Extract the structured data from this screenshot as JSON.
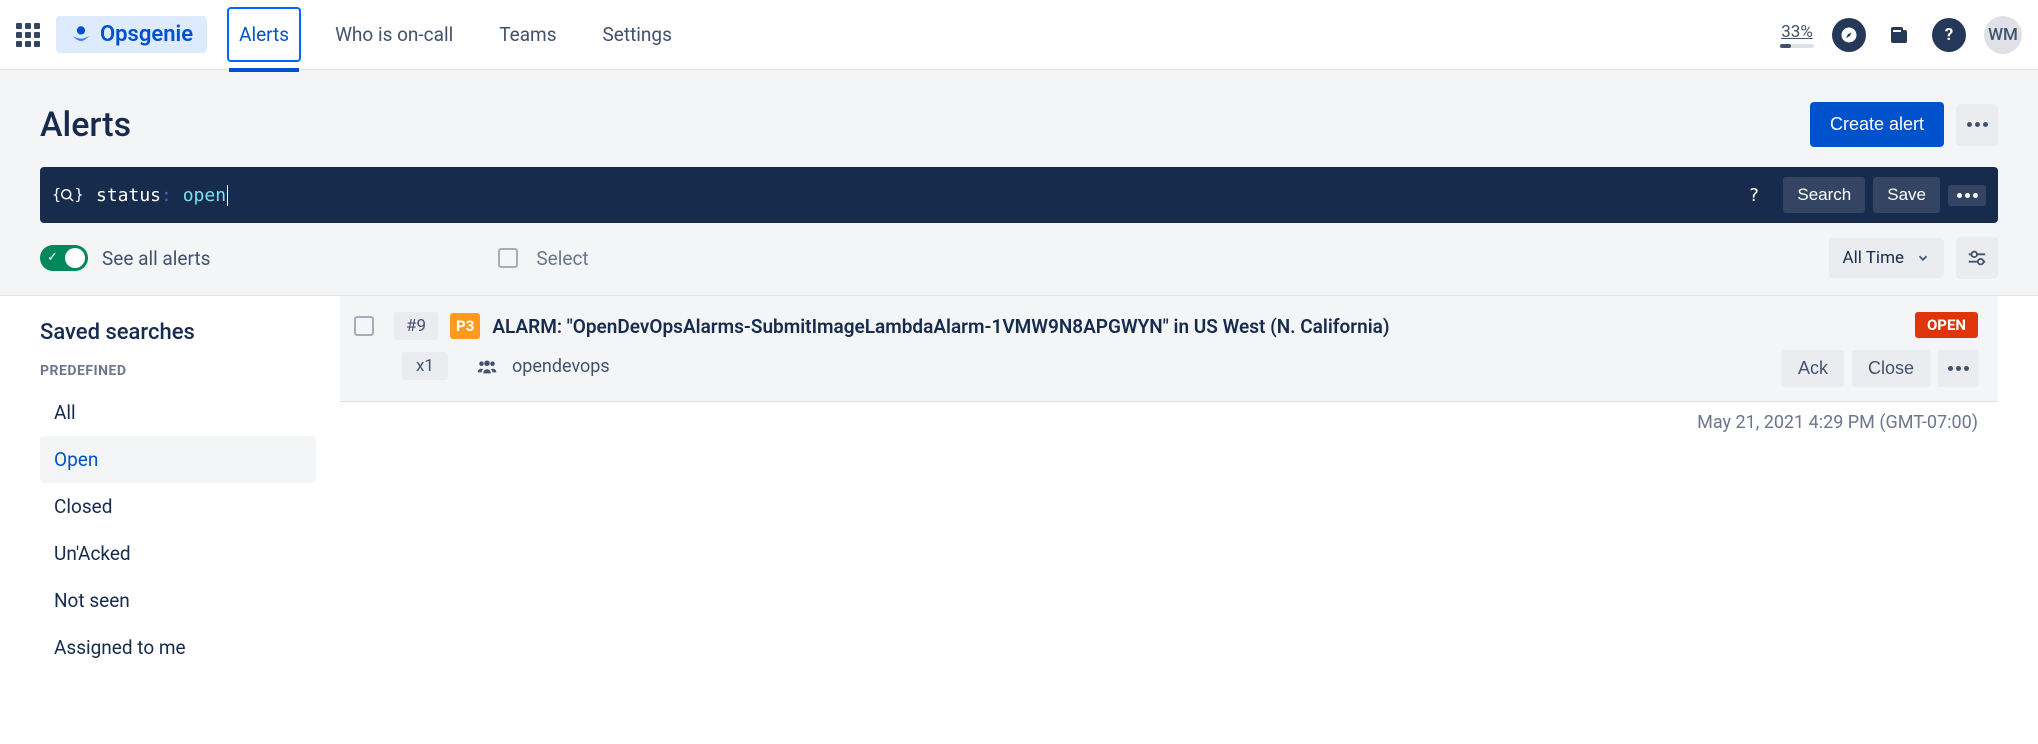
{
  "brand": "Opsgenie",
  "nav": {
    "tabs": [
      "Alerts",
      "Who is on-call",
      "Teams",
      "Settings"
    ],
    "activeIndex": 0
  },
  "topRight": {
    "percent": "33%",
    "avatar": "WM"
  },
  "page": {
    "title": "Alerts",
    "createLabel": "Create alert"
  },
  "query": {
    "key": "status",
    "value": "open",
    "searchLabel": "Search",
    "saveLabel": "Save"
  },
  "toolbar": {
    "toggleLabel": "See all alerts",
    "selectLabel": "Select",
    "timeLabel": "All Time"
  },
  "sidebar": {
    "header": "Saved searches",
    "subheader": "PREDEFINED",
    "items": [
      "All",
      "Open",
      "Closed",
      "Un'Acked",
      "Not seen",
      "Assigned to me"
    ],
    "activeIndex": 1
  },
  "alert": {
    "id": "#9",
    "priority": "P3",
    "title": "ALARM: \"OpenDevOpsAlarms-SubmitImageLambdaAlarm-1VMW9N8APGWYN\" in US West (N. California)",
    "count": "x1",
    "team": "opendevops",
    "status": "OPEN",
    "ackLabel": "Ack",
    "closeLabel": "Close",
    "timestamp": "May 21, 2021 4:29 PM (GMT-07:00)"
  }
}
